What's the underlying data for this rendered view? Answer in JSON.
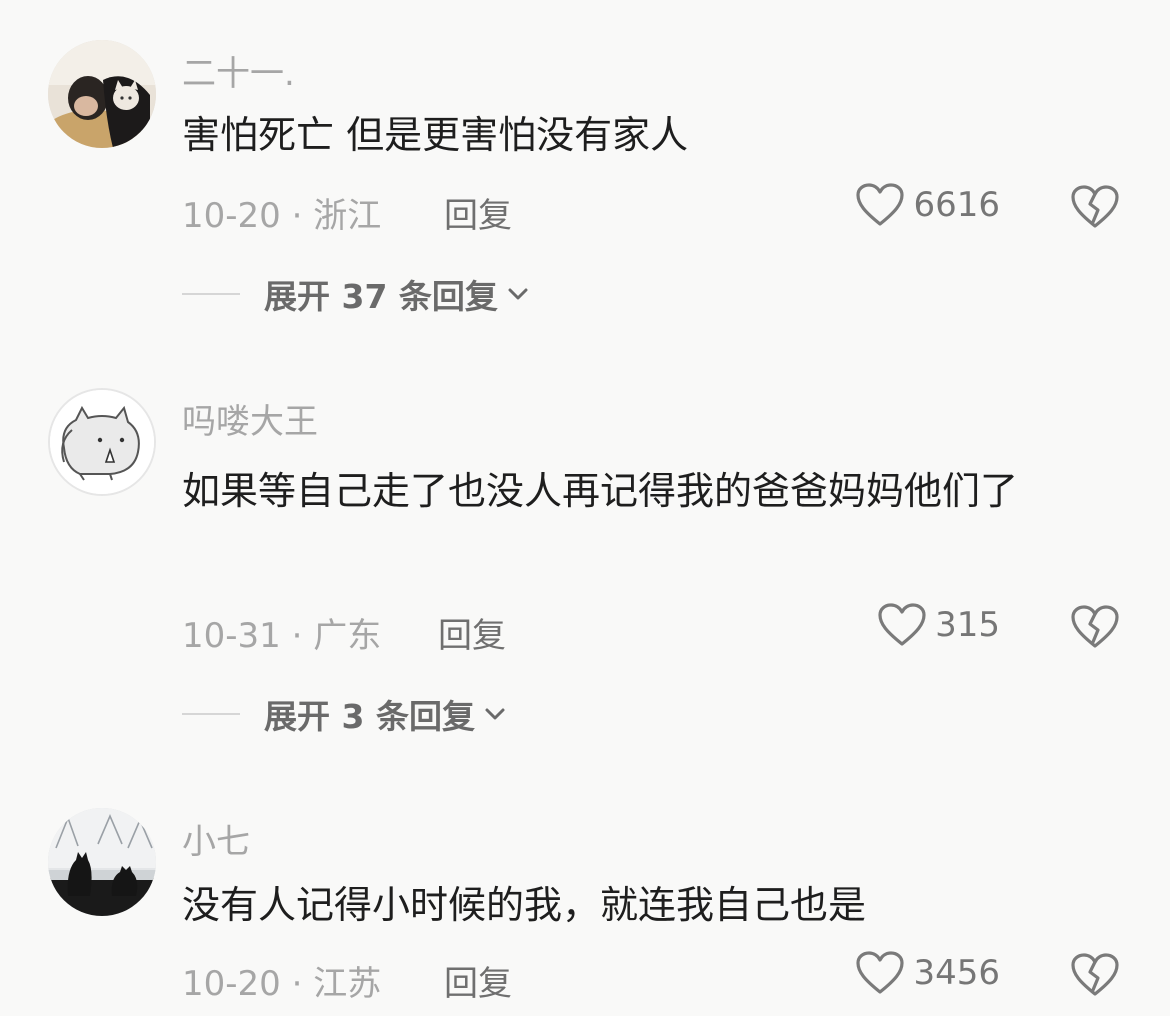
{
  "comments": [
    {
      "username": "二十一.",
      "text": "害怕死亡 但是更害怕没有家人",
      "date_location": "10-20 · 浙江",
      "reply_label": "回复",
      "likes": "6616",
      "expand_label": "展开 37 条回复",
      "avatar_icon": "avatar-person-with-cat-icon"
    },
    {
      "username": "吗喽大王",
      "text": "如果等自己走了也没人再记得我的爸爸妈妈他们了",
      "date_location": "10-31 · 广东",
      "reply_label": "回复",
      "likes": "315",
      "expand_label": "展开 3 条回复",
      "avatar_icon": "avatar-cartoon-animal-icon"
    },
    {
      "username": "小七",
      "text": "没有人记得小时候的我，就连我自己也是",
      "date_location": "10-20 · 江苏",
      "reply_label": "回复",
      "likes": "3456",
      "avatar_icon": "avatar-cats-in-snow-icon"
    }
  ],
  "colors": {
    "background": "#f9f9f8",
    "text_primary": "#1e1e1e",
    "text_secondary": "#a6a6a6"
  }
}
